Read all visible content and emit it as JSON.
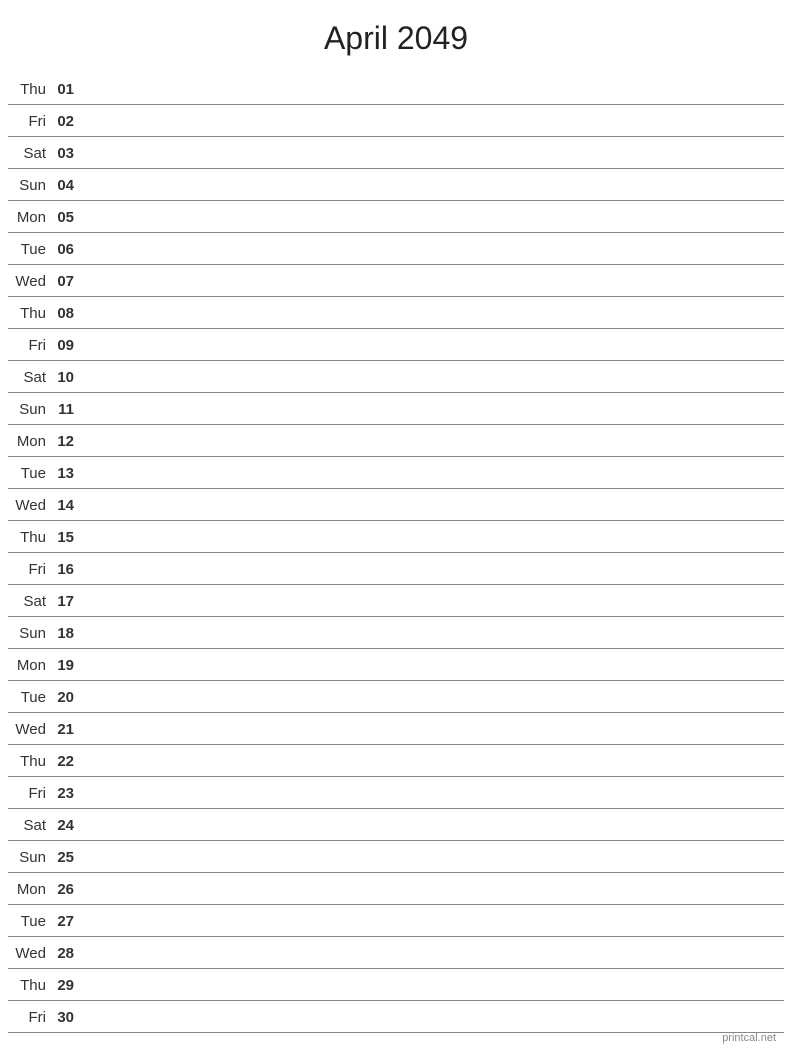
{
  "page": {
    "title": "April 2049",
    "footer": "printcal.net"
  },
  "days": [
    {
      "name": "Thu",
      "number": "01"
    },
    {
      "name": "Fri",
      "number": "02"
    },
    {
      "name": "Sat",
      "number": "03"
    },
    {
      "name": "Sun",
      "number": "04"
    },
    {
      "name": "Mon",
      "number": "05"
    },
    {
      "name": "Tue",
      "number": "06"
    },
    {
      "name": "Wed",
      "number": "07"
    },
    {
      "name": "Thu",
      "number": "08"
    },
    {
      "name": "Fri",
      "number": "09"
    },
    {
      "name": "Sat",
      "number": "10"
    },
    {
      "name": "Sun",
      "number": "11"
    },
    {
      "name": "Mon",
      "number": "12"
    },
    {
      "name": "Tue",
      "number": "13"
    },
    {
      "name": "Wed",
      "number": "14"
    },
    {
      "name": "Thu",
      "number": "15"
    },
    {
      "name": "Fri",
      "number": "16"
    },
    {
      "name": "Sat",
      "number": "17"
    },
    {
      "name": "Sun",
      "number": "18"
    },
    {
      "name": "Mon",
      "number": "19"
    },
    {
      "name": "Tue",
      "number": "20"
    },
    {
      "name": "Wed",
      "number": "21"
    },
    {
      "name": "Thu",
      "number": "22"
    },
    {
      "name": "Fri",
      "number": "23"
    },
    {
      "name": "Sat",
      "number": "24"
    },
    {
      "name": "Sun",
      "number": "25"
    },
    {
      "name": "Mon",
      "number": "26"
    },
    {
      "name": "Tue",
      "number": "27"
    },
    {
      "name": "Wed",
      "number": "28"
    },
    {
      "name": "Thu",
      "number": "29"
    },
    {
      "name": "Fri",
      "number": "30"
    }
  ]
}
